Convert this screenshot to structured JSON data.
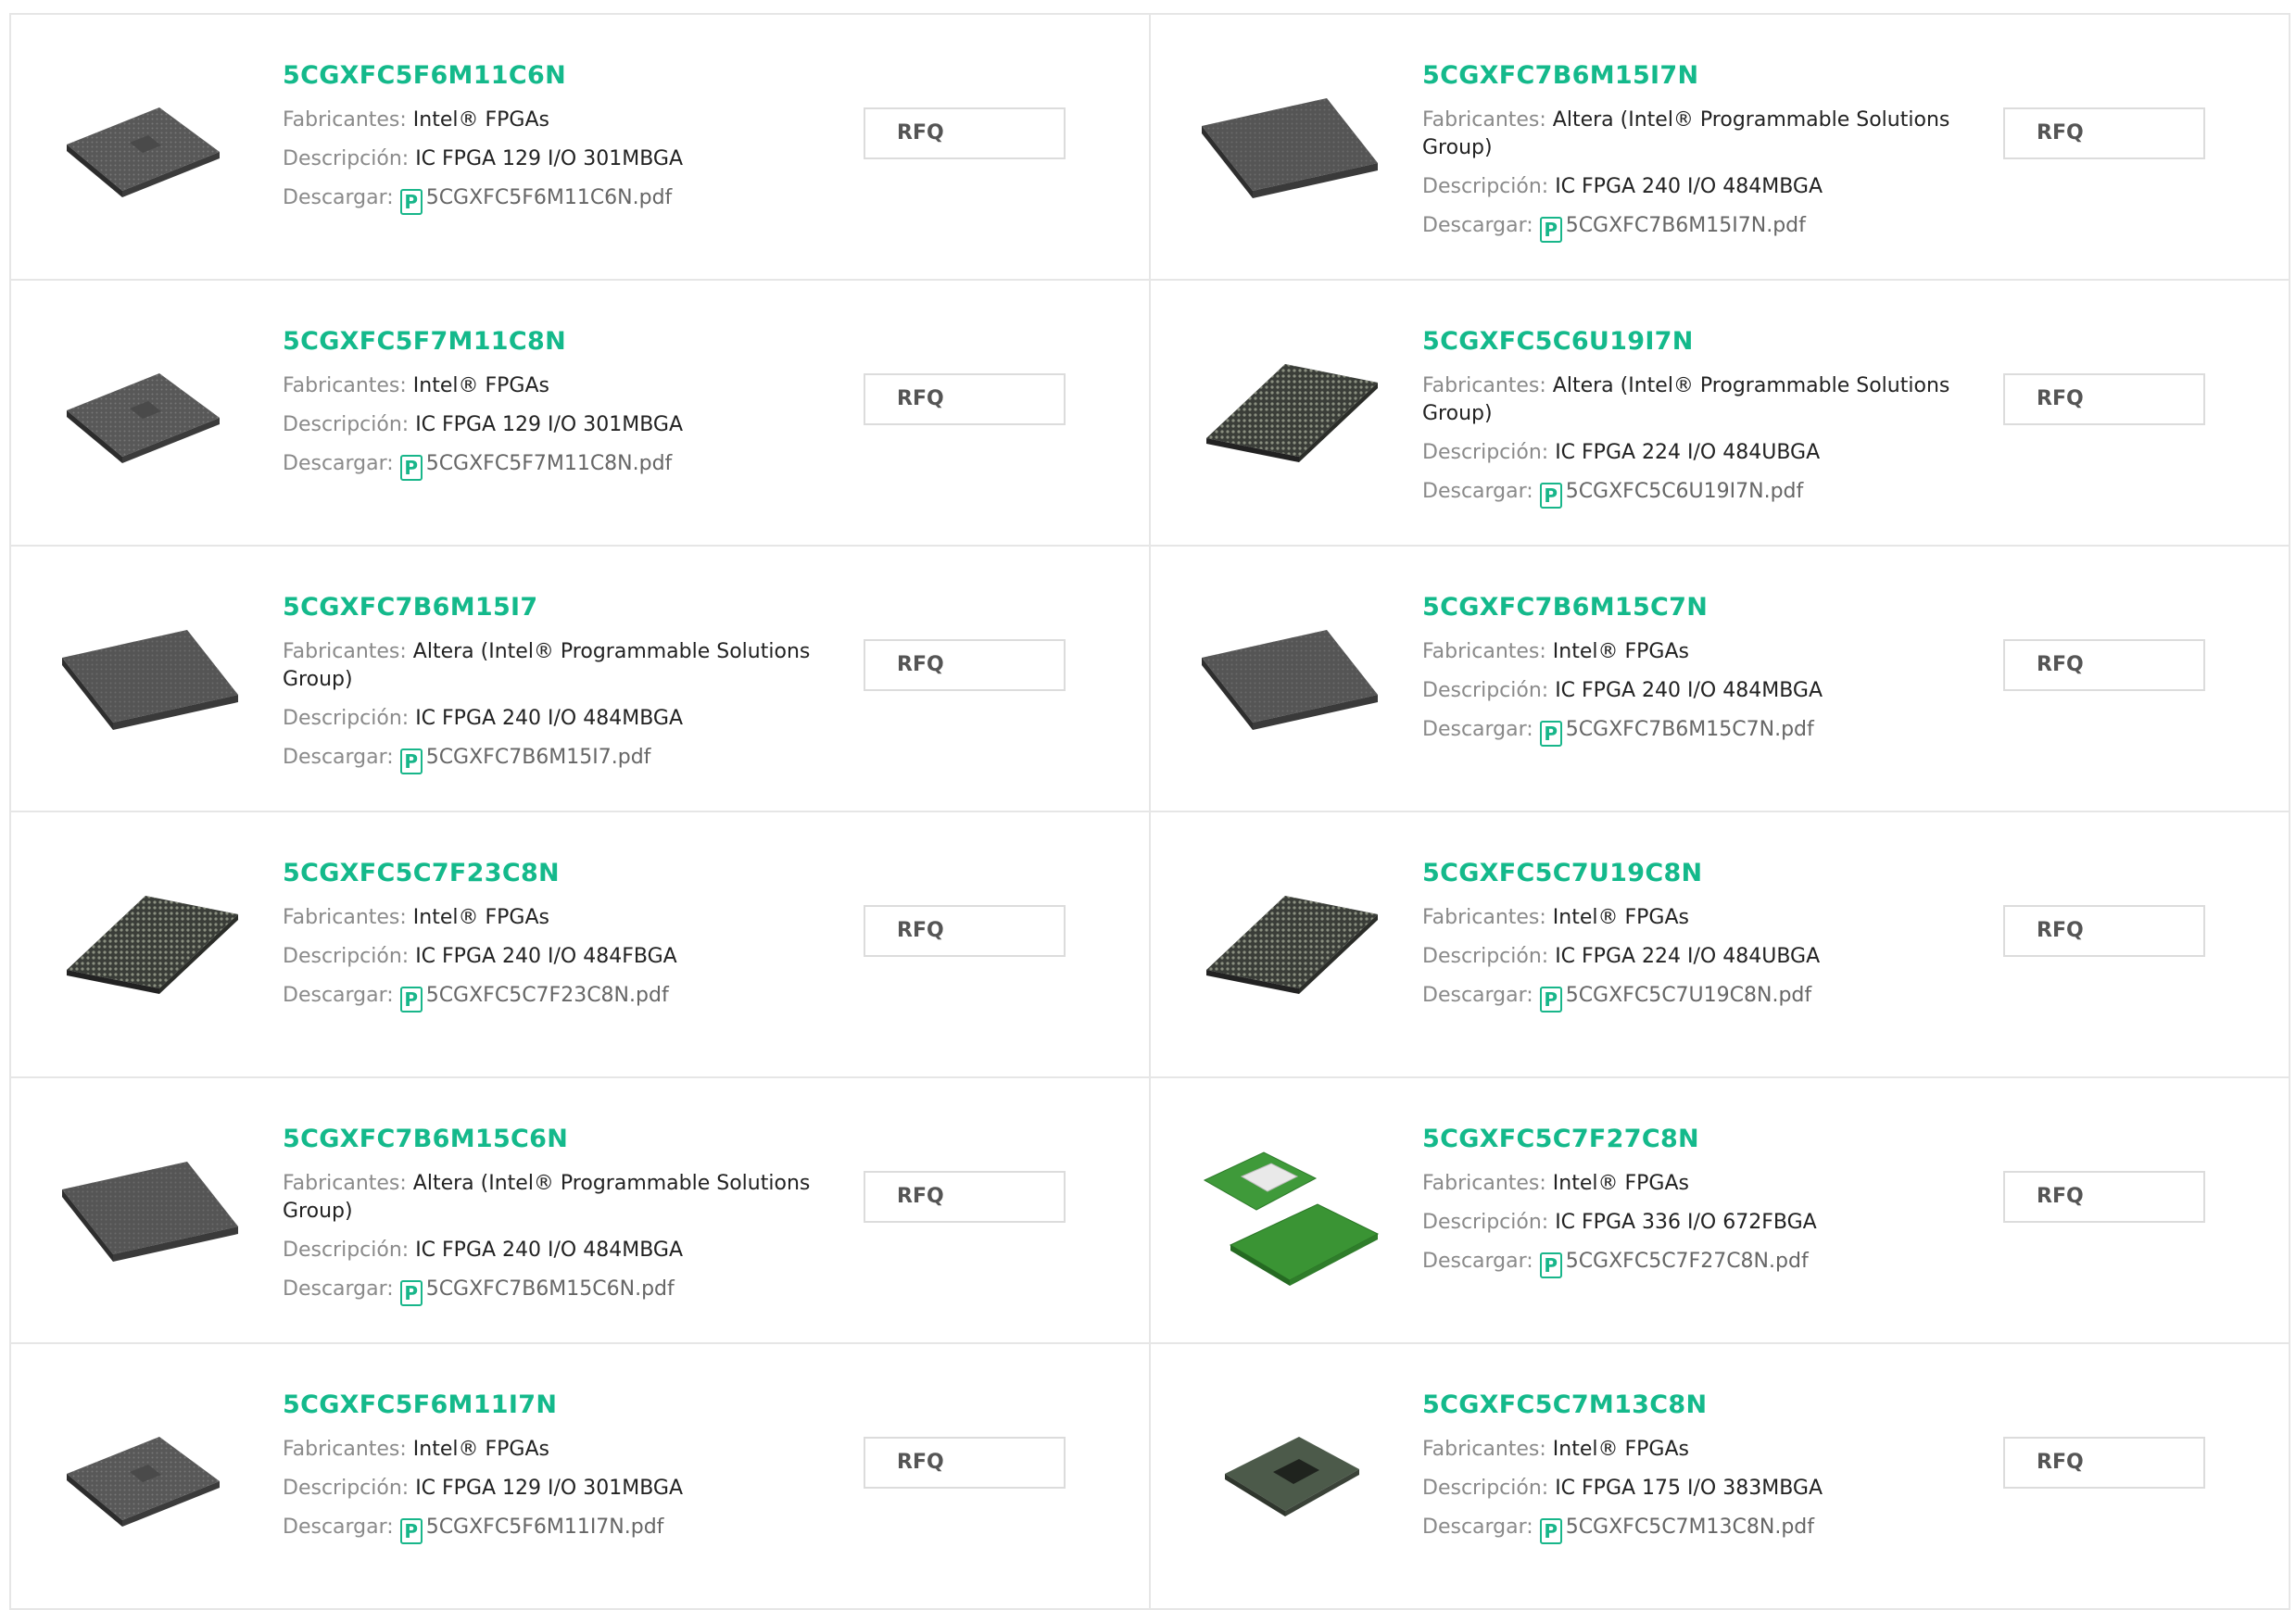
{
  "labels": {
    "manufacturer": "Fabricantes:",
    "description": "Descripción:",
    "download": "Descargar:",
    "rfq": "RFQ",
    "pdf_glyph": "P"
  },
  "products": [
    {
      "part": "5CGXFC5F6M11C6N",
      "manufacturer": "Intel® FPGAs",
      "description": "IC FPGA 129 I/O 301MBGA",
      "file": "5CGXFC5F6M11C6N.pdf",
      "image": "bga-flat-chip"
    },
    {
      "part": "5CGXFC7B6M15I7N",
      "manufacturer": "Altera (Intel® Programmable Solutions Group)",
      "description": "IC FPGA 240 I/O 484MBGA",
      "file": "5CGXFC7B6M15I7N.pdf",
      "image": "bga-pattern-chip"
    },
    {
      "part": "5CGXFC5F7M11C8N",
      "manufacturer": "Intel® FPGAs",
      "description": "IC FPGA 129 I/O 301MBGA",
      "file": "5CGXFC5F7M11C8N.pdf",
      "image": "bga-flat-chip"
    },
    {
      "part": "5CGXFC5C6U19I7N",
      "manufacturer": "Altera (Intel® Programmable Solutions Group)",
      "description": "IC FPGA 224 I/O 484UBGA",
      "file": "5CGXFC5C6U19I7N.pdf",
      "image": "bga-ball-chip"
    },
    {
      "part": "5CGXFC7B6M15I7",
      "manufacturer": "Altera (Intel® Programmable Solutions Group)",
      "description": "IC FPGA 240 I/O 484MBGA",
      "file": "5CGXFC7B6M15I7.pdf",
      "image": "bga-pattern-chip"
    },
    {
      "part": "5CGXFC7B6M15C7N",
      "manufacturer": "Intel® FPGAs",
      "description": "IC FPGA 240 I/O 484MBGA",
      "file": "5CGXFC7B6M15C7N.pdf",
      "image": "bga-pattern-chip"
    },
    {
      "part": "5CGXFC5C7F23C8N",
      "manufacturer": "Intel® FPGAs",
      "description": "IC FPGA 240 I/O 484FBGA",
      "file": "5CGXFC5C7F23C8N.pdf",
      "image": "bga-ball-chip"
    },
    {
      "part": "5CGXFC5C7U19C8N",
      "manufacturer": "Intel® FPGAs",
      "description": "IC FPGA 224 I/O 484UBGA",
      "file": "5CGXFC5C7U19C8N.pdf",
      "image": "bga-ball-chip"
    },
    {
      "part": "5CGXFC7B6M15C6N",
      "manufacturer": "Altera (Intel® Programmable Solutions Group)",
      "description": "IC FPGA 240 I/O 484MBGA",
      "file": "5CGXFC7B6M15C6N.pdf",
      "image": "bga-pattern-chip"
    },
    {
      "part": "5CGXFC5C7F27C8N",
      "manufacturer": "Intel® FPGAs",
      "description": "IC FPGA 336 I/O 672FBGA",
      "file": "5CGXFC5C7F27C8N.pdf",
      "image": "green-fbga-chip"
    },
    {
      "part": "5CGXFC5F6M11I7N",
      "manufacturer": "Intel® FPGAs",
      "description": "IC FPGA 129 I/O 301MBGA",
      "file": "5CGXFC5F6M11I7N.pdf",
      "image": "bga-flat-chip"
    },
    {
      "part": "5CGXFC5C7M13C8N",
      "manufacturer": "Intel® FPGAs",
      "description": "IC FPGA 175 I/O 383MBGA",
      "file": "5CGXFC5C7M13C8N.pdf",
      "image": "bga-center-chip"
    }
  ]
}
